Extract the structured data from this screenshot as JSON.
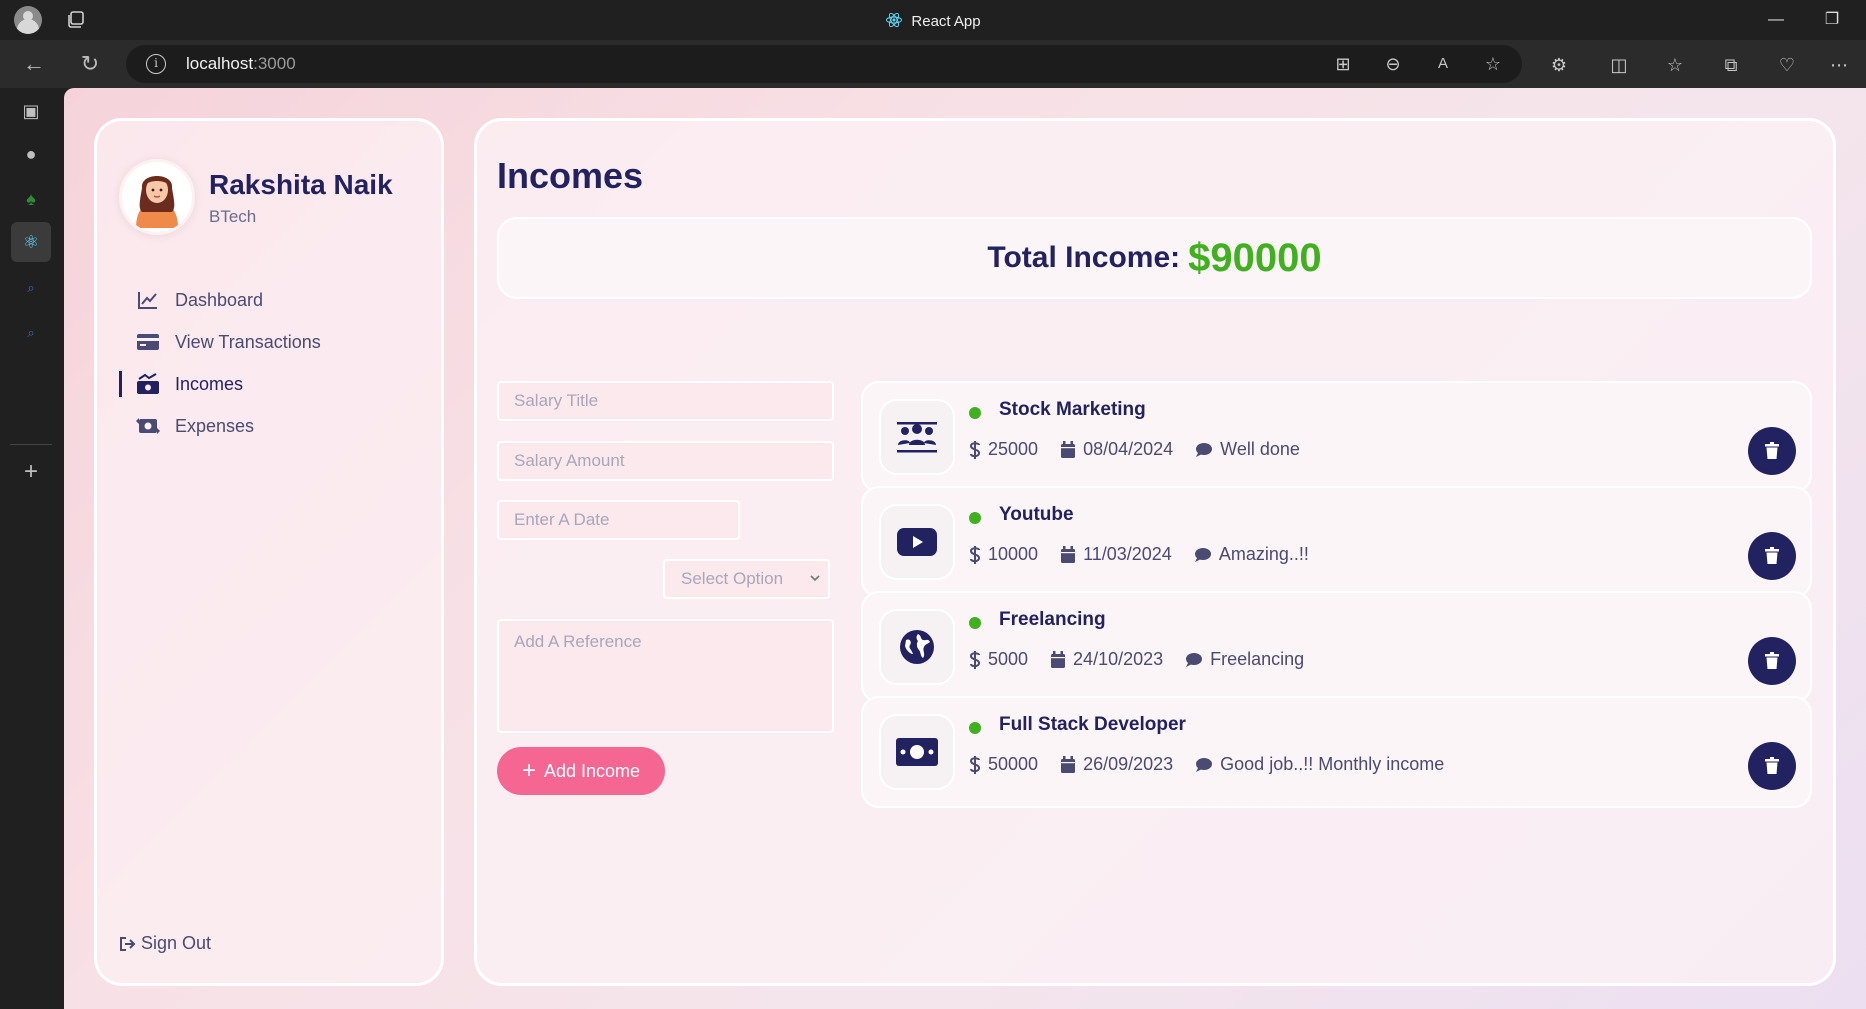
{
  "browser": {
    "tab_title": "React App",
    "url_host": "localhost",
    "url_port": ":3000"
  },
  "user": {
    "name": "Rakshita Naik",
    "role": "BTech"
  },
  "menu": [
    {
      "label": "Dashboard",
      "icon": "chart-line-icon",
      "active": false
    },
    {
      "label": "View Transactions",
      "icon": "credit-card-icon",
      "active": false
    },
    {
      "label": "Incomes",
      "icon": "money-trend-icon",
      "active": true
    },
    {
      "label": "Expenses",
      "icon": "money-exchange-icon",
      "active": false
    }
  ],
  "signout_label": "Sign Out",
  "page_title": "Incomes",
  "total": {
    "label": "Total Income:",
    "value": "$90000"
  },
  "form": {
    "title_placeholder": "Salary Title",
    "amount_placeholder": "Salary Amount",
    "date_placeholder": "Enter A Date",
    "select_value": "Select Option",
    "reference_placeholder": "Add A Reference",
    "submit_label": "Add Income"
  },
  "incomes": [
    {
      "title": "Stock Marketing",
      "amount": "25000",
      "date": "08/04/2024",
      "note": "Well done",
      "icon": "users-icon"
    },
    {
      "title": "Youtube",
      "amount": "10000",
      "date": "11/03/2024",
      "note": "Amazing..!!",
      "icon": "youtube-icon"
    },
    {
      "title": "Freelancing",
      "amount": "5000",
      "date": "24/10/2023",
      "note": "Freelancing",
      "icon": "globe-icon"
    },
    {
      "title": "Full Stack Developer",
      "amount": "50000",
      "date": "26/09/2023",
      "note": "Good job..!! Monthly income",
      "icon": "money-bill-icon"
    }
  ],
  "colors": {
    "primary": "#222260",
    "accent": "#f56692",
    "green": "#3fb01e"
  }
}
